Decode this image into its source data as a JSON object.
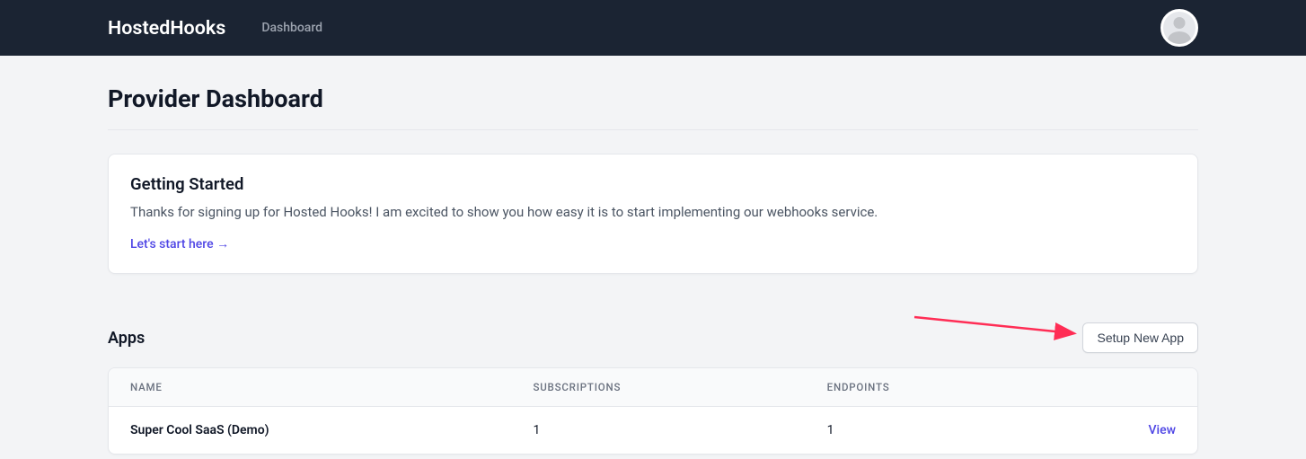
{
  "header": {
    "logo": "HostedHooks",
    "nav_dashboard": "Dashboard"
  },
  "page": {
    "title": "Provider Dashboard"
  },
  "getting_started": {
    "title": "Getting Started",
    "body": "Thanks for signing up for Hosted Hooks! I am excited to show you how easy it is to start implementing our webhooks service.",
    "link_text": "Let's start here →"
  },
  "apps": {
    "section_title": "Apps",
    "setup_button": "Setup New App",
    "columns": {
      "name": "Name",
      "subscriptions": "Subscriptions",
      "endpoints": "Endpoints"
    },
    "rows": [
      {
        "name": "Super Cool SaaS (Demo)",
        "subscriptions": "1",
        "endpoints": "1",
        "view_label": "View"
      }
    ]
  }
}
